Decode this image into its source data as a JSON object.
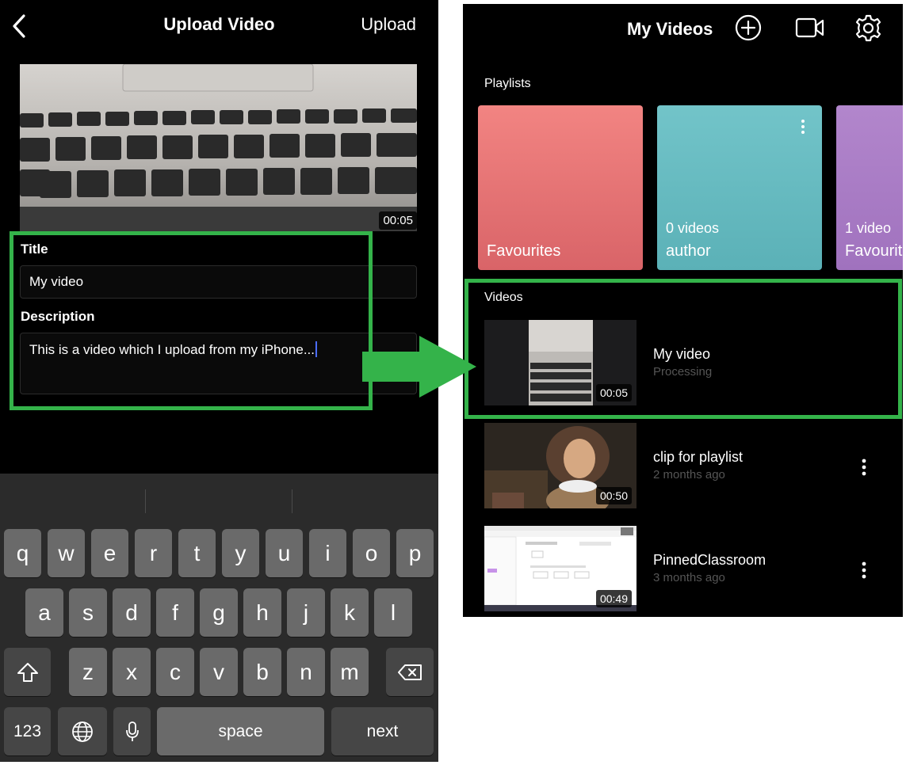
{
  "upload_screen": {
    "title": "Upload Video",
    "upload_label": "Upload",
    "preview_duration": "00:05",
    "form": {
      "title_label": "Title",
      "title_value": "My video",
      "description_label": "Description",
      "description_value": "This is a video which I upload from my iPhone..."
    },
    "keyboard": {
      "row1": [
        "q",
        "w",
        "e",
        "r",
        "t",
        "y",
        "u",
        "i",
        "o",
        "p"
      ],
      "row2": [
        "a",
        "s",
        "d",
        "f",
        "g",
        "h",
        "j",
        "k",
        "l"
      ],
      "row3": [
        "z",
        "x",
        "c",
        "v",
        "b",
        "n",
        "m"
      ],
      "numbers_key": "123",
      "space_key": "space",
      "next_key": "next"
    }
  },
  "videos_screen": {
    "title": "My Videos",
    "playlists_label": "Playlists",
    "playlists": [
      {
        "name": "Favourites",
        "count": "",
        "color_top": "#f28482",
        "color_bottom": "#d96468"
      },
      {
        "name": "author",
        "count": "0 videos",
        "color_top": "#72c4c9",
        "color_bottom": "#5bb1b7"
      },
      {
        "name": "Favourites",
        "count": "1 video",
        "color_top": "#b286cc",
        "color_bottom": "#a072be"
      }
    ],
    "videos_label": "Videos",
    "videos": [
      {
        "title": "My video",
        "subtitle": "Processing",
        "duration": "00:05"
      },
      {
        "title": "clip for playlist",
        "subtitle": "2 months ago",
        "duration": "00:50"
      },
      {
        "title": "PinnedClassroom",
        "subtitle": "3 months ago",
        "duration": "00:49"
      }
    ]
  },
  "annotation_color": "#34b34a"
}
